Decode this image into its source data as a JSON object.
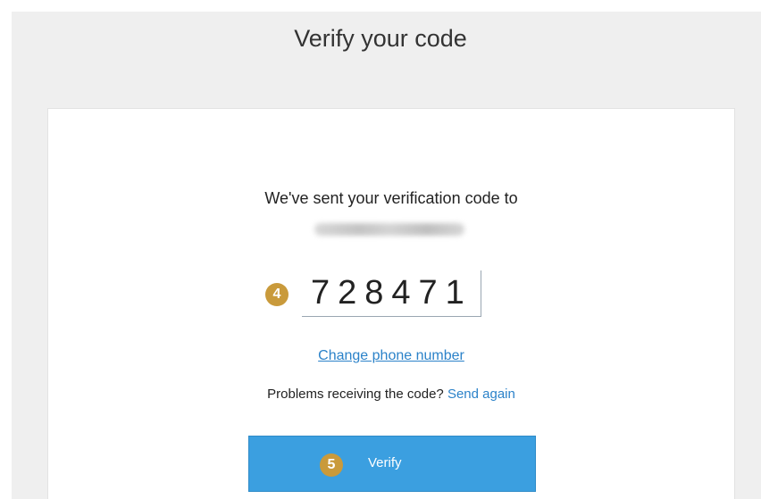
{
  "header": {
    "title": "Verify your code"
  },
  "card": {
    "sent_message": "We've sent your verification code to",
    "phone_number_blurred": true,
    "code_value": "728471",
    "change_phone_label": "Change phone number",
    "problems_text": "Problems receiving the code?",
    "send_again_label": "Send again",
    "verify_label": "Verify"
  },
  "annotations": {
    "step_code": "4",
    "step_verify": "5"
  },
  "colors": {
    "link": "#2b82c9",
    "button": "#3b9fe0",
    "badge": "#c99a3b",
    "backdrop": "#efefef"
  }
}
